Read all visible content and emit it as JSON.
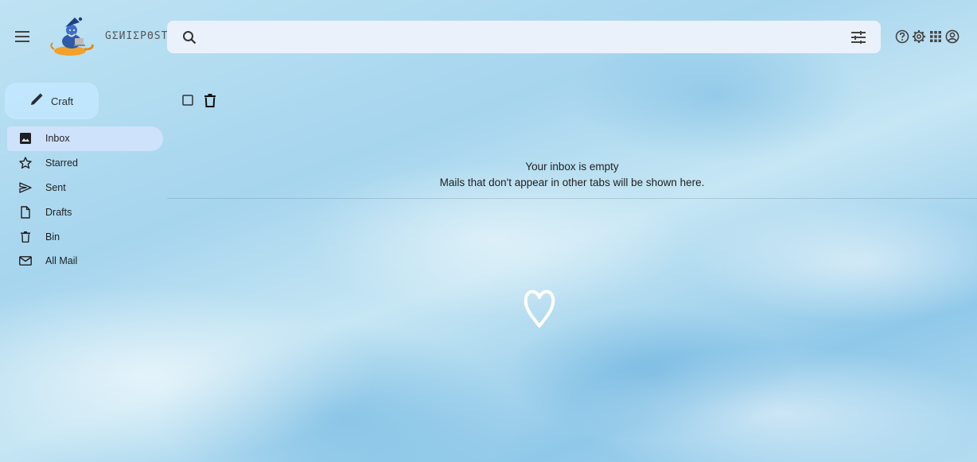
{
  "app": {
    "brand": "GΣИIΣPΘST"
  },
  "search": {
    "placeholder": "",
    "value": ""
  },
  "compose": {
    "label": "Craft"
  },
  "sidebar": {
    "items": [
      {
        "label": "Inbox",
        "icon": "inbox-icon",
        "active": true
      },
      {
        "label": "Starred",
        "icon": "star-icon",
        "active": false
      },
      {
        "label": "Sent",
        "icon": "send-icon",
        "active": false
      },
      {
        "label": "Drafts",
        "icon": "draft-icon",
        "active": false
      },
      {
        "label": "Bin",
        "icon": "trash-icon",
        "active": false
      },
      {
        "label": "All Mail",
        "icon": "mail-icon",
        "active": false
      }
    ]
  },
  "main": {
    "empty_title": "Your inbox is empty",
    "empty_subtitle": "Mails that don't appear in other tabs will be shown here."
  },
  "header_icons": [
    "help-icon",
    "gear-icon",
    "apps-grid-icon",
    "account-icon"
  ],
  "colors": {
    "compose_bg": "#c2e7ff",
    "active_nav_bg": "#d3e3fd",
    "search_bg": "#eaf1fb"
  }
}
